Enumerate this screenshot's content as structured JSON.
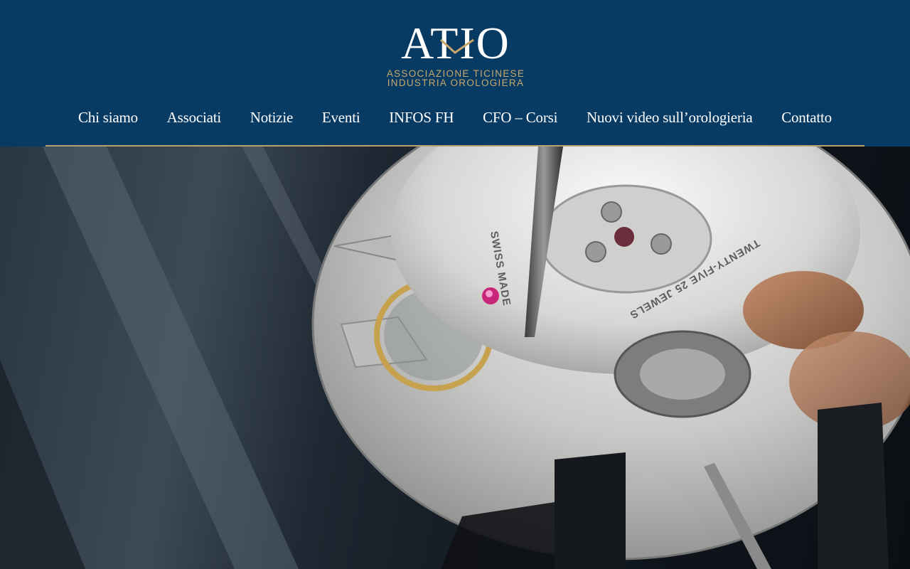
{
  "brand": {
    "logo_text": "ATIO",
    "tagline_line1": "ASSOCIAZIONE TICINESE",
    "tagline_line2": "INDUSTRIA OROLOGIERA",
    "colors": {
      "header_bg": "#073b64",
      "accent_gold": "#c8a86a",
      "nav_text": "#ffffff"
    }
  },
  "nav": {
    "items": [
      {
        "label": "Chi siamo"
      },
      {
        "label": "Associati"
      },
      {
        "label": "Notizie"
      },
      {
        "label": "Eventi"
      },
      {
        "label": "INFOS FH"
      },
      {
        "label": "CFO – Corsi"
      },
      {
        "label": "Nuovi video sull’orologieria"
      },
      {
        "label": "Contatto"
      }
    ]
  },
  "hero": {
    "image_subject": "watch-movement-photo",
    "engraving_1": "SWISS MADE",
    "engraving_2": "TWENTY-FIVE 25 JEWELS"
  }
}
